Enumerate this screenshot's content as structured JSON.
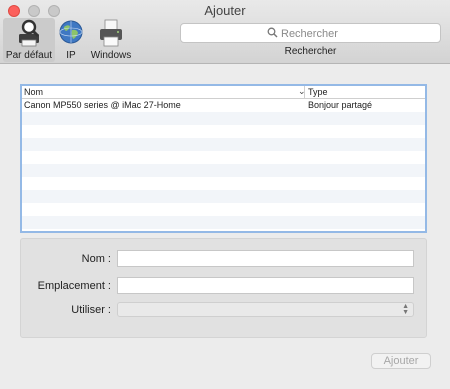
{
  "window": {
    "title": "Ajouter"
  },
  "toolbar": {
    "tools": [
      {
        "label": "Par défaut",
        "icon": "printer-magnifier-icon"
      },
      {
        "label": "IP",
        "icon": "globe-icon"
      },
      {
        "label": "Windows",
        "icon": "printer-icon"
      }
    ],
    "search": {
      "placeholder": "Rechercher",
      "value": "",
      "label": "Rechercher"
    }
  },
  "printer_list": {
    "columns": [
      "Nom",
      "Type"
    ],
    "rows": [
      {
        "name": "Canon MP550 series @ iMac 27-Home",
        "type": "Bonjour partagé"
      }
    ]
  },
  "form": {
    "name_label": "Nom :",
    "name_value": "",
    "location_label": "Emplacement :",
    "location_value": "",
    "use_label": "Utiliser :",
    "use_value": ""
  },
  "actions": {
    "add_label": "Ajouter"
  },
  "colors": {
    "accent_border": "#94b9e6",
    "close": "#fc605c"
  }
}
